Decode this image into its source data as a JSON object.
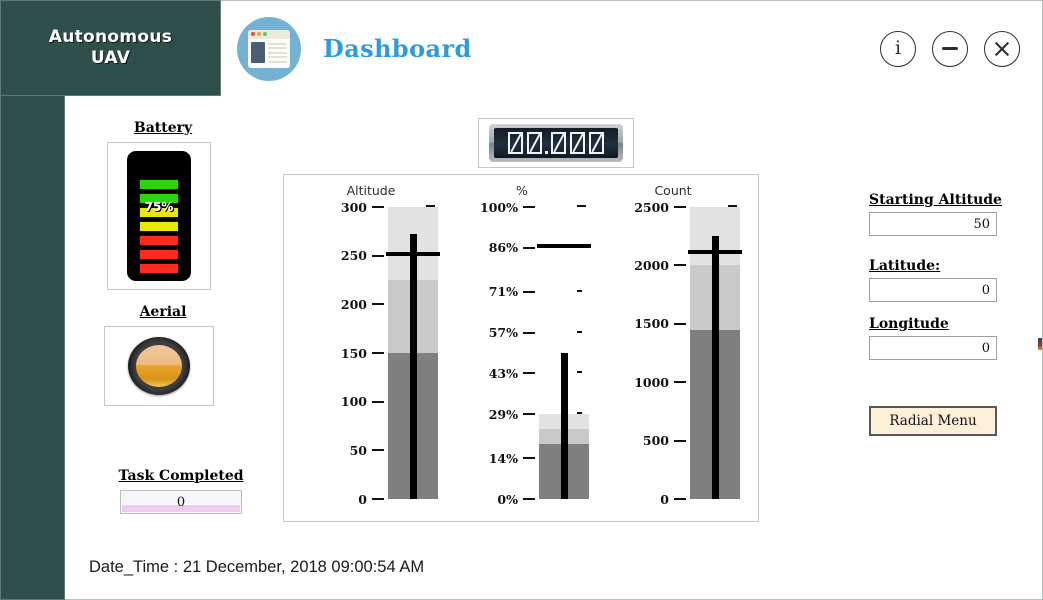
{
  "brand": {
    "name": "Autonomous\nUAV",
    "line1": "Autonomous",
    "line2": "UAV"
  },
  "header": {
    "title": "Dashboard",
    "icon": "dashboard-window-icon",
    "controls": [
      {
        "name": "info-button",
        "glyph": "i"
      },
      {
        "name": "minimize-button",
        "glyph": "—"
      },
      {
        "name": "close-button",
        "glyph": "✕"
      }
    ]
  },
  "battery": {
    "label": "Battery",
    "value_text": "75%",
    "value": 75,
    "cells": [
      {
        "color": "#ff2b1e"
      },
      {
        "color": "#ff2b1e"
      },
      {
        "color": "#ff2b1e"
      },
      {
        "color": "#e8e80f"
      },
      {
        "color": "#e8e80f"
      },
      {
        "color": "#2bd40b"
      },
      {
        "color": "#2bd40b"
      }
    ]
  },
  "aerial": {
    "label": "Aerial",
    "state_color": "#e8a32b",
    "state": "on"
  },
  "task": {
    "label": "Task Completed",
    "value": "0",
    "fill_color": "#eccdec"
  },
  "counter": {
    "name": "digital-counter",
    "digits": [
      "0",
      "0",
      "0",
      "0",
      "0"
    ],
    "decimal_after_index": 1,
    "value_text": "00.000"
  },
  "form": {
    "starting_altitude": {
      "label": "Starting Altitude",
      "value": "50"
    },
    "latitude": {
      "label": "Latitude:",
      "value": "0"
    },
    "longitude": {
      "label": "Longitude",
      "value": "0"
    },
    "radial_menu_button": "Radial Menu"
  },
  "datetime": {
    "text": "Date_Time : 21 December, 2018 09:00:54 AM"
  },
  "colors": {
    "brand_teal": "#2f4f4b",
    "title_blue": "#2e9bdc",
    "zone_low": "#7f7f7f",
    "zone_mid": "#c9c9c9",
    "zone_high": "#e2e2e2",
    "needle": "#000000",
    "button_cream": "#fdefd8"
  },
  "chart_data": [
    {
      "type": "bar",
      "title": "Altitude",
      "ylabel": "Altitude",
      "ylim": [
        0,
        300
      ],
      "ticks": [
        0,
        50,
        100,
        150,
        200,
        250,
        300
      ],
      "tick_labels": [
        "0",
        "50",
        "100",
        "150",
        "200",
        "250",
        "300"
      ],
      "value": 272,
      "marker": 250,
      "zones": [
        {
          "from": 0,
          "to": 150,
          "color": "#7f7f7f"
        },
        {
          "from": 150,
          "to": 225,
          "color": "#c9c9c9"
        },
        {
          "from": 225,
          "to": 300,
          "color": "#e2e2e2"
        }
      ]
    },
    {
      "type": "bar",
      "title": "%",
      "ylabel": "%",
      "ylim": [
        0,
        100
      ],
      "ticks": [
        0,
        14,
        29,
        43,
        57,
        71,
        86,
        100
      ],
      "tick_labels": [
        "0%",
        "14%",
        "29%",
        "43%",
        "57%",
        "71%",
        "86%",
        "100%"
      ],
      "value": 50,
      "marker": 86,
      "zones": [
        {
          "from": 0,
          "to": 19,
          "color": "#7f7f7f"
        },
        {
          "from": 19,
          "to": 24,
          "color": "#c9c9c9"
        },
        {
          "from": 24,
          "to": 29,
          "color": "#e2e2e2"
        }
      ]
    },
    {
      "type": "bar",
      "title": "Count",
      "ylabel": "Count",
      "ylim": [
        0,
        2500
      ],
      "ticks": [
        0,
        500,
        1000,
        1500,
        2000,
        2500
      ],
      "tick_labels": [
        "0",
        "500",
        "1000",
        "1500",
        "2000",
        "2500"
      ],
      "value": 2250,
      "marker": 2100,
      "zones": [
        {
          "from": 0,
          "to": 1450,
          "color": "#7f7f7f"
        },
        {
          "from": 1450,
          "to": 2000,
          "color": "#c9c9c9"
        },
        {
          "from": 2000,
          "to": 2500,
          "color": "#e2e2e2"
        }
      ]
    }
  ]
}
